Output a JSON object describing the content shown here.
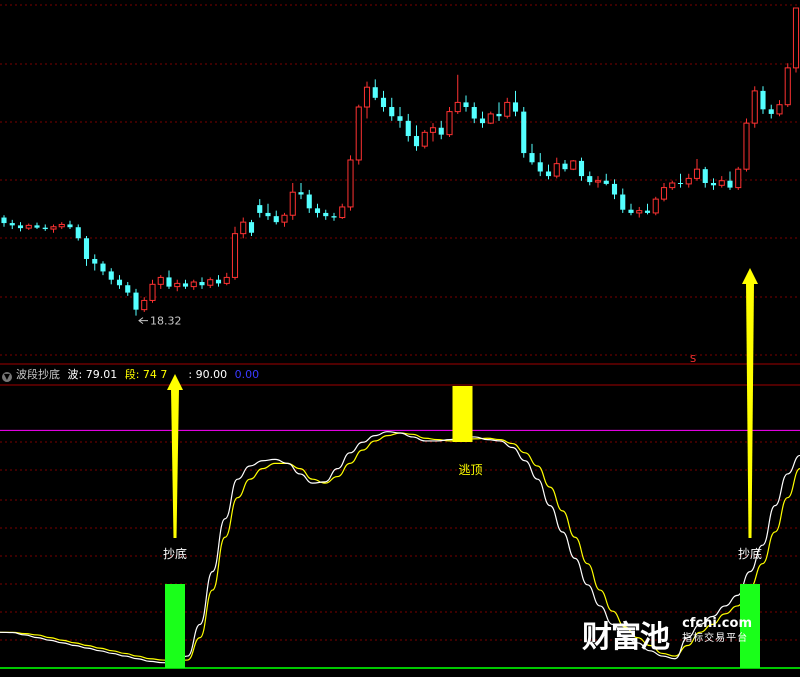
{
  "indicator": {
    "name": "波段抄底",
    "wave_label": "波: 79.01",
    "seg_label": "段: 74",
    "seg_suffix": "7",
    "level_label": ": 90.00",
    "zero_label": "0.00",
    "colors": {
      "name": "#c8c8c8",
      "wave": "#ffffff",
      "seg": "#ffff00",
      "level": "#ffffff",
      "zero": "#3a3aff"
    }
  },
  "annotations": {
    "low_price": "18.32",
    "sell_top": "逃顶",
    "buy_bottom_1": "抄底",
    "buy_bottom_2": "抄底",
    "marker_s": "S"
  },
  "watermark": {
    "brand": "财富池",
    "url": "cfchi.com",
    "tagline": "指标交易平台"
  },
  "chart_data": [
    {
      "type": "candlestick",
      "title": "",
      "colors": {
        "up": "#ff3232",
        "down": "#54ffff"
      },
      "price_range": [
        17.4,
        25.0
      ],
      "annotated_low": 18.32,
      "candles": [
        [
          20.45,
          20.5,
          20.25,
          20.33
        ],
        [
          20.33,
          20.4,
          20.2,
          20.28
        ],
        [
          20.28,
          20.35,
          20.15,
          20.22
        ],
        [
          20.22,
          20.32,
          20.18,
          20.28
        ],
        [
          20.28,
          20.34,
          20.2,
          20.23
        ],
        [
          20.23,
          20.3,
          20.16,
          20.2
        ],
        [
          20.2,
          20.3,
          20.12,
          20.25
        ],
        [
          20.25,
          20.35,
          20.2,
          20.3
        ],
        [
          20.3,
          20.38,
          20.2,
          20.24
        ],
        [
          20.24,
          20.3,
          19.95,
          20.0
        ],
        [
          20.0,
          20.05,
          19.4,
          19.55
        ],
        [
          19.55,
          19.65,
          19.3,
          19.45
        ],
        [
          19.45,
          19.5,
          19.2,
          19.28
        ],
        [
          19.28,
          19.35,
          19.0,
          19.1
        ],
        [
          19.1,
          19.2,
          18.9,
          18.98
        ],
        [
          18.98,
          19.05,
          18.75,
          18.82
        ],
        [
          18.82,
          18.9,
          18.32,
          18.45
        ],
        [
          18.45,
          18.72,
          18.4,
          18.65
        ],
        [
          18.65,
          19.1,
          18.6,
          19.0
        ],
        [
          19.0,
          19.2,
          18.9,
          19.15
        ],
        [
          19.15,
          19.3,
          18.9,
          18.95
        ],
        [
          18.95,
          19.1,
          18.85,
          19.02
        ],
        [
          19.02,
          19.1,
          18.9,
          18.95
        ],
        [
          18.95,
          19.1,
          18.88,
          19.05
        ],
        [
          19.05,
          19.15,
          18.9,
          18.98
        ],
        [
          18.98,
          19.15,
          18.92,
          19.1
        ],
        [
          19.1,
          19.2,
          18.95,
          19.02
        ],
        [
          19.02,
          19.25,
          18.98,
          19.15
        ],
        [
          19.15,
          20.25,
          19.1,
          20.1
        ],
        [
          20.1,
          20.45,
          20.0,
          20.35
        ],
        [
          20.35,
          20.4,
          20.05,
          20.12
        ],
        [
          20.72,
          20.85,
          20.45,
          20.55
        ],
        [
          20.55,
          20.75,
          20.4,
          20.48
        ],
        [
          20.48,
          20.6,
          20.3,
          20.35
        ],
        [
          20.35,
          20.55,
          20.25,
          20.5
        ],
        [
          20.5,
          21.2,
          20.4,
          21.0
        ],
        [
          21.0,
          21.2,
          20.85,
          20.95
        ],
        [
          20.95,
          21.05,
          20.55,
          20.65
        ],
        [
          20.65,
          20.75,
          20.45,
          20.55
        ],
        [
          20.55,
          20.62,
          20.4,
          20.48
        ],
        [
          20.48,
          20.55,
          20.38,
          20.45
        ],
        [
          20.45,
          20.75,
          20.42,
          20.68
        ],
        [
          20.68,
          21.8,
          20.6,
          21.7
        ],
        [
          21.7,
          22.9,
          21.6,
          22.85
        ],
        [
          22.85,
          23.4,
          22.6,
          23.28
        ],
        [
          23.28,
          23.45,
          23.0,
          23.05
        ],
        [
          23.05,
          23.2,
          22.75,
          22.85
        ],
        [
          22.85,
          23.05,
          22.55,
          22.65
        ],
        [
          22.65,
          22.85,
          22.4,
          22.55
        ],
        [
          22.55,
          22.7,
          22.1,
          22.22
        ],
        [
          22.22,
          22.45,
          21.9,
          22.0
        ],
        [
          22.0,
          22.35,
          21.95,
          22.3
        ],
        [
          22.3,
          22.5,
          22.1,
          22.4
        ],
        [
          22.4,
          22.55,
          22.15,
          22.25
        ],
        [
          22.25,
          22.85,
          22.2,
          22.75
        ],
        [
          22.75,
          23.55,
          22.7,
          22.95
        ],
        [
          22.95,
          23.1,
          22.75,
          22.85
        ],
        [
          22.85,
          22.95,
          22.5,
          22.6
        ],
        [
          22.6,
          22.75,
          22.4,
          22.5
        ],
        [
          22.5,
          22.75,
          22.48,
          22.7
        ],
        [
          22.7,
          22.95,
          22.55,
          22.65
        ],
        [
          22.65,
          23.05,
          22.6,
          22.95
        ],
        [
          22.95,
          23.2,
          22.65,
          22.75
        ],
        [
          22.75,
          22.85,
          21.75,
          21.85
        ],
        [
          21.85,
          22.05,
          21.6,
          21.65
        ],
        [
          21.65,
          21.85,
          21.35,
          21.45
        ],
        [
          21.45,
          21.6,
          21.28,
          21.35
        ],
        [
          21.35,
          21.75,
          21.3,
          21.62
        ],
        [
          21.62,
          21.7,
          21.45,
          21.5
        ],
        [
          21.5,
          21.7,
          21.48,
          21.68
        ],
        [
          21.68,
          21.75,
          21.25,
          21.35
        ],
        [
          21.35,
          21.45,
          21.15,
          21.22
        ],
        [
          21.22,
          21.35,
          21.1,
          21.25
        ],
        [
          21.25,
          21.4,
          21.15,
          21.18
        ],
        [
          21.18,
          21.28,
          20.85,
          20.95
        ],
        [
          20.95,
          21.08,
          20.55,
          20.62
        ],
        [
          20.62,
          20.75,
          20.5,
          20.55
        ],
        [
          20.55,
          20.68,
          20.45,
          20.6
        ],
        [
          20.6,
          20.75,
          20.52,
          20.55
        ],
        [
          20.55,
          20.9,
          20.5,
          20.85
        ],
        [
          20.85,
          21.2,
          20.8,
          21.1
        ],
        [
          21.1,
          21.25,
          21.05,
          21.2
        ],
        [
          21.2,
          21.4,
          21.1,
          21.18
        ],
        [
          21.18,
          21.4,
          21.1,
          21.3
        ],
        [
          21.3,
          21.72,
          21.25,
          21.5
        ],
        [
          21.5,
          21.55,
          21.1,
          21.2
        ],
        [
          21.2,
          21.3,
          21.05,
          21.15
        ],
        [
          21.15,
          21.35,
          21.1,
          21.25
        ],
        [
          21.25,
          21.45,
          21.05,
          21.1
        ],
        [
          21.1,
          21.55,
          21.05,
          21.5
        ],
        [
          21.5,
          22.6,
          21.45,
          22.5
        ],
        [
          22.5,
          23.3,
          22.4,
          23.2
        ],
        [
          23.2,
          23.3,
          22.7,
          22.8
        ],
        [
          22.8,
          22.9,
          22.6,
          22.7
        ],
        [
          22.7,
          23.0,
          22.65,
          22.9
        ],
        [
          22.9,
          23.8,
          22.85,
          23.7
        ],
        [
          23.7,
          25.0,
          23.6,
          25.0
        ]
      ]
    },
    {
      "type": "line",
      "title": "波段抄底",
      "ylim": [
        0,
        100
      ],
      "levels": [
        90,
        0
      ],
      "series": [
        {
          "name": "波",
          "color": "#ffffff",
          "values": [
            12,
            11.9,
            11,
            10,
            9,
            8,
            7,
            6,
            5,
            4,
            3,
            2,
            1,
            0.5,
            0.4,
            3,
            15,
            35,
            55,
            70,
            75,
            77,
            77.5,
            76,
            72,
            68.5,
            69,
            74,
            80,
            84,
            86.5,
            88,
            87.5,
            86,
            84.5,
            84.5,
            85,
            86,
            86,
            85,
            84.5,
            82,
            77,
            70,
            60,
            50,
            40,
            30,
            22,
            15,
            10,
            8,
            5,
            3,
            2,
            10,
            15,
            18,
            22,
            26,
            35,
            45,
            60,
            72,
            79
          ]
        },
        {
          "name": "段",
          "color": "#ffff00",
          "values": [
            12,
            12,
            11.5,
            11,
            10,
            9,
            8,
            7,
            6,
            5,
            4,
            3,
            2,
            1.5,
            1,
            1.5,
            10,
            28,
            48,
            63,
            70,
            74,
            76,
            76,
            74,
            70,
            68.5,
            71,
            76,
            81,
            84.5,
            86.5,
            87.5,
            87,
            85.5,
            85,
            84.5,
            84.8,
            85.3,
            85.5,
            85,
            83.5,
            80,
            75,
            67,
            58,
            48,
            38,
            28,
            20,
            14,
            10,
            7,
            4,
            3,
            7,
            12,
            15,
            19,
            22,
            29,
            38,
            50,
            63,
            74
          ]
        }
      ],
      "signals": [
        {
          "type": "buy",
          "label": "抄底",
          "index": 14
        },
        {
          "type": "sell",
          "label": "逃顶",
          "index": 37
        },
        {
          "type": "buy",
          "label": "抄底",
          "index": 60
        }
      ]
    }
  ]
}
